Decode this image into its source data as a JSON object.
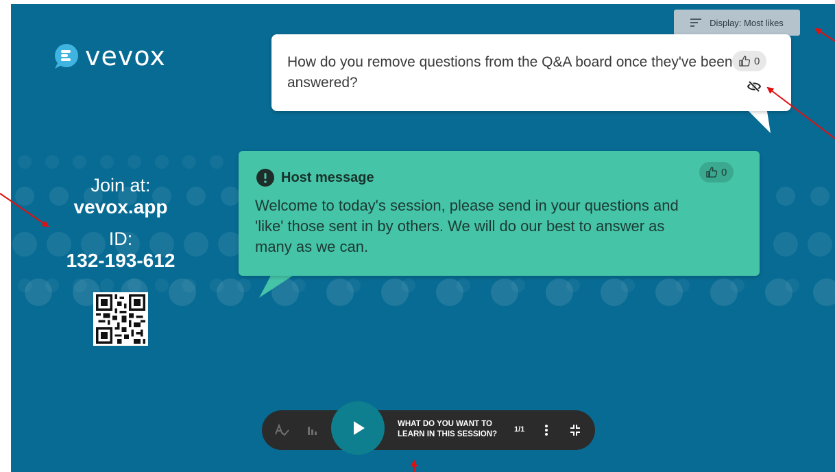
{
  "app": {
    "brand": "vevox"
  },
  "join": {
    "join_label": "Join at:",
    "join_url": "vevox.app",
    "id_label": "ID:",
    "id_value": "132-193-612"
  },
  "toolbar": {
    "sort_label": "Display: Most likes",
    "sort_icon": "sort-lines-icon"
  },
  "question": {
    "text": "How do you remove questions from the Q&A board once they've been answered?",
    "likes": "0",
    "like_icon": "thumbs-up-icon",
    "hide_icon": "eye-off-icon"
  },
  "host_message": {
    "title": "Host message",
    "text": "Welcome to today's session, please send in your questions and 'like' those sent in by others. We will do our best to answer as many as we can.",
    "likes": "0"
  },
  "control_bar": {
    "question_title": "WHAT DO YOU WANT TO LEARN IN THIS SESSION?",
    "counter": "1/1"
  },
  "colors": {
    "background": "#086b93",
    "host_card": "#45c4a7",
    "question_card": "#ffffff",
    "control_bar": "#2b2b2b",
    "play_button": "#0d7f8f",
    "annotation_arrow": "#e01010"
  }
}
